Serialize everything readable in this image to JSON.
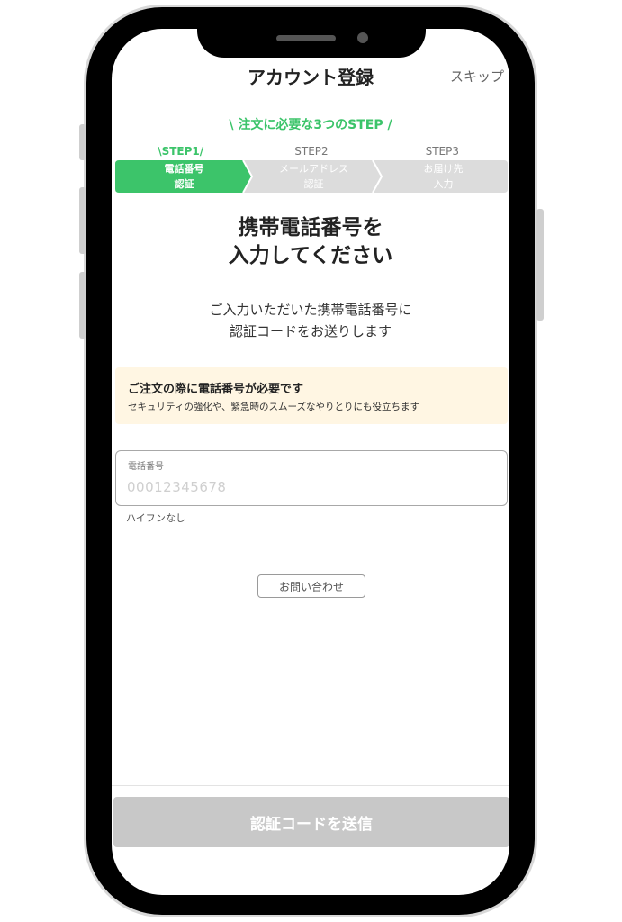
{
  "header": {
    "title": "アカウント登録",
    "skip_label": "スキップ"
  },
  "steps": {
    "caption": "\\ 注文に必要な3つのSTEP /",
    "items": [
      {
        "label": "\\STEP1/",
        "line1": "電話番号",
        "line2": "認証",
        "active": true
      },
      {
        "label": "STEP2",
        "line1": "メールアドレス",
        "line2": "認証",
        "active": false
      },
      {
        "label": "STEP3",
        "line1": "お届け先",
        "line2": "入力",
        "active": false
      }
    ]
  },
  "main": {
    "heading_line1": "携帯電話番号を",
    "heading_line2": "入力してください",
    "desc_line1": "ご入力いただいた携帯電話番号に",
    "desc_line2": "認証コードをお送りします"
  },
  "notice": {
    "title": "ご注文の際に電話番号が必要です",
    "body": "セキュリティの強化や、緊急時のスムーズなやりとりにも役立ちます"
  },
  "phone_field": {
    "label": "電話番号",
    "value": "",
    "placeholder": "00012345678",
    "hint": "ハイフンなし"
  },
  "contact_button": {
    "label": "お問い合わせ"
  },
  "submit_button": {
    "label": "認証コードを送信"
  },
  "colors": {
    "accent_green": "#3cc46a",
    "step_inactive": "#dcdcdc",
    "notice_bg": "#fff6e3",
    "submit_disabled": "#c8c8c8"
  }
}
